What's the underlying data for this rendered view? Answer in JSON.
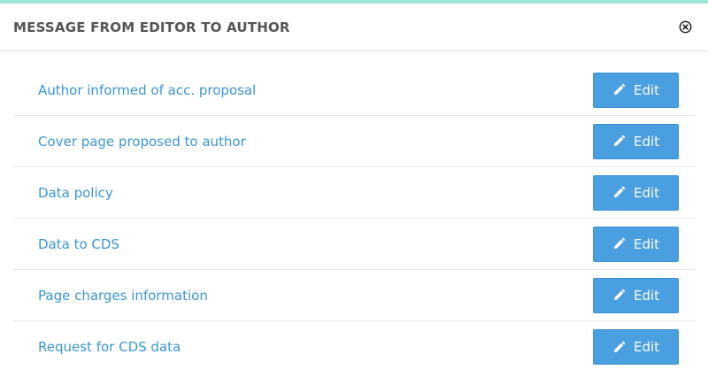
{
  "modal": {
    "title": "MESSAGE FROM EDITOR TO AUTHOR",
    "close_icon": "close-circle-icon"
  },
  "items": [
    {
      "label": "Author informed of acc. proposal",
      "button_label": "Edit",
      "button_icon": "pencil-icon"
    },
    {
      "label": "Cover page proposed to author",
      "button_label": "Edit",
      "button_icon": "pencil-icon"
    },
    {
      "label": "Data policy",
      "button_label": "Edit",
      "button_icon": "pencil-icon"
    },
    {
      "label": "Data to CDS",
      "button_label": "Edit",
      "button_icon": "pencil-icon"
    },
    {
      "label": "Page charges information",
      "button_label": "Edit",
      "button_icon": "pencil-icon"
    },
    {
      "label": "Request for CDS data",
      "button_label": "Edit",
      "button_icon": "pencil-icon"
    }
  ],
  "colors": {
    "accent_top_border": "#9fe3d4",
    "link": "#3a95d4",
    "button": "#4a9fe0",
    "title": "#555555"
  }
}
